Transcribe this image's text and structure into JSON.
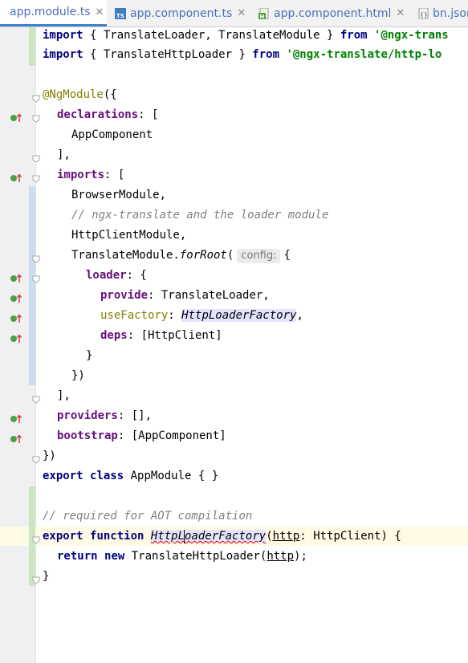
{
  "tabs": [
    {
      "label": "app.module.ts",
      "active": true,
      "icon": "typescript-file-icon"
    },
    {
      "label": "app.component.ts",
      "active": false,
      "icon": "typescript-file-icon"
    },
    {
      "label": "app.component.html",
      "active": false,
      "icon": "html-file-icon"
    },
    {
      "label": "bn.json",
      "active": false,
      "icon": "json-file-icon"
    }
  ],
  "close_glyph": "✕",
  "code": {
    "l1": {
      "kw1": "import",
      "t1": " { TranslateLoader, TranslateModule } ",
      "kw2": "from",
      "str": " '@ngx-trans"
    },
    "l2": {
      "kw1": "import",
      "t1": " { TranslateHttpLoader } ",
      "kw2": "from",
      "str": " '@ngx-translate/http-lo"
    },
    "l3": {
      "ann": "@NgModule",
      "t": "({"
    },
    "l4": {
      "prop": "declarations",
      "t": ": ["
    },
    "l5": {
      "t": "AppComponent"
    },
    "l6": {
      "t": "],"
    },
    "l7": {
      "prop": "imports",
      "t": ": ["
    },
    "l8": {
      "t": "BrowserModule,"
    },
    "l9": {
      "cmt": "// ngx-translate and the loader module"
    },
    "l10": {
      "t": "HttpClientModule,"
    },
    "l11": {
      "t1": "TranslateModule.",
      "fn": "forRoot",
      "t2": "(",
      "hint": "config:",
      "t3": "{"
    },
    "l12": {
      "prop": "loader",
      "t": ": {"
    },
    "l13": {
      "prop": "provide",
      "t": ": TranslateLoader,"
    },
    "l14": {
      "prop": "useFactory",
      "t1": ": ",
      "fn": "HttpLoaderFactory",
      "t2": ","
    },
    "l15": {
      "prop": "deps",
      "t": ": [HttpClient]"
    },
    "l16": {
      "t": "}"
    },
    "l17": {
      "t": "})"
    },
    "l18": {
      "t": "],"
    },
    "l19": {
      "prop": "providers",
      "t": ": [],"
    },
    "l20": {
      "prop": "bootstrap",
      "t": ": [AppComponent]"
    },
    "l21": {
      "t": "})"
    },
    "l22": {
      "kw1": "export",
      "kw2": "class",
      "t": " AppModule { }"
    },
    "l23": {
      "cmt": "// required for AOT compilation"
    },
    "l24": {
      "kw1": "export",
      "kw2": "function",
      "fn_a": "HttpL",
      "fn_b": "oaderFactory",
      "t1": "(",
      "param": "http",
      "t2": ": HttpClient) {"
    },
    "l25": {
      "kw1": "return",
      "kw2": "new",
      "t1": " TranslateHttpLoader(",
      "param": "http",
      "t2": ");"
    },
    "l26": {
      "t": "}"
    }
  },
  "colors": {
    "keyword": "#000080",
    "string": "#008000",
    "comment": "#808080",
    "annotation": "#808000",
    "property": "#660e7a",
    "tab_label": "#4a70b8",
    "active_tab_underline": "#4083c9"
  }
}
